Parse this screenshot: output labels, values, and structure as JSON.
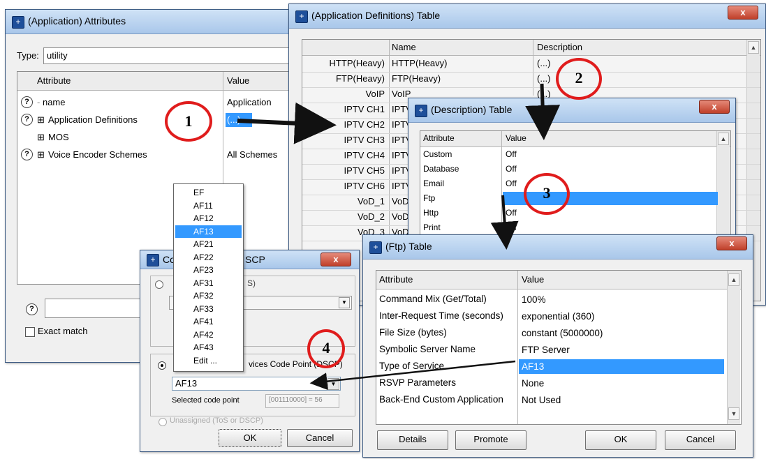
{
  "attributes_window": {
    "title": "(Application) Attributes",
    "type_label": "Type:",
    "type_value": "utility",
    "col_attribute": "Attribute",
    "col_value": "Value",
    "rows": [
      {
        "attr": "name",
        "value": "Application"
      },
      {
        "attr": "Application Definitions",
        "value": "(...)"
      },
      {
        "attr": "MOS",
        "value": ""
      },
      {
        "attr": "Voice Encoder Schemes",
        "value": "All Schemes"
      }
    ],
    "exact_match_label": "Exact match"
  },
  "app_defs_window": {
    "title": "(Application Definitions) Table",
    "col_name": "Name",
    "col_description": "Description",
    "rows": [
      {
        "label": "HTTP(Heavy)",
        "name": "HTTP(Heavy)",
        "desc": "(...)"
      },
      {
        "label": "FTP(Heavy)",
        "name": "FTP(Heavy)",
        "desc": "(...)"
      },
      {
        "label": "VoIP",
        "name": "VoIP",
        "desc": "(...)"
      },
      {
        "label": "IPTV CH1",
        "name": "IPTV",
        "desc": ""
      },
      {
        "label": "IPTV CH2",
        "name": "IPTV",
        "desc": ""
      },
      {
        "label": "IPTV CH3",
        "name": "IPTV",
        "desc": ""
      },
      {
        "label": "IPTV CH4",
        "name": "IPTV",
        "desc": ""
      },
      {
        "label": "IPTV CH5",
        "name": "IPTV",
        "desc": ""
      },
      {
        "label": "IPTV CH6",
        "name": "IPTV",
        "desc": ""
      },
      {
        "label": "VoD_1",
        "name": "VoD",
        "desc": ""
      },
      {
        "label": "VoD_2",
        "name": "VoD",
        "desc": ""
      },
      {
        "label": "VoD_3",
        "name": "VoD",
        "desc": ""
      }
    ]
  },
  "description_window": {
    "title": "(Description) Table",
    "col_attribute": "Attribute",
    "col_value": "Value",
    "rows": [
      {
        "attr": "Custom",
        "value": "Off"
      },
      {
        "attr": "Database",
        "value": "Off"
      },
      {
        "attr": "Email",
        "value": "Off"
      },
      {
        "attr": "Ftp",
        "value": ""
      },
      {
        "attr": "Http",
        "value": "Off"
      },
      {
        "attr": "Print",
        "value": "Off"
      }
    ]
  },
  "ftp_window": {
    "title": "(Ftp) Table",
    "col_attribute": "Attribute",
    "col_value": "Value",
    "rows": [
      {
        "attr": "Command Mix (Get/Total)",
        "value": "100%"
      },
      {
        "attr": "Inter-Request Time (seconds)",
        "value": "exponential (360)"
      },
      {
        "attr": "File Size (bytes)",
        "value": "constant (5000000)"
      },
      {
        "attr": "Symbolic Server Name",
        "value": "FTP Server"
      },
      {
        "attr": "Type of Service",
        "value": "AF13"
      },
      {
        "attr": "RSVP Parameters",
        "value": "None"
      },
      {
        "attr": "Back-End Custom Application",
        "value": "Not Used"
      }
    ],
    "details_btn": "Details",
    "promote_btn": "Promote",
    "ok_btn": "OK",
    "cancel_btn": "Cancel"
  },
  "tos_window": {
    "title_left": "Co",
    "title_right": "SCP",
    "radio1_text": "S)",
    "radio2_text": "vices Code Point (DSCP)",
    "select_value": "AF13",
    "selected_code_label": "Selected code point",
    "selected_code_value": "[001110000] = 56",
    "radio3_text": "Unassigned (ToS or DSCP)",
    "ok_btn": "OK",
    "cancel_btn": "Cancel"
  },
  "dropdown": {
    "options": [
      "EF",
      "AF11",
      "AF12",
      "AF13",
      "AF21",
      "AF22",
      "AF23",
      "AF31",
      "AF32",
      "AF33",
      "AF41",
      "AF42",
      "AF43",
      "Edit ..."
    ],
    "selected": "AF13"
  },
  "callouts": [
    "1",
    "2",
    "3",
    "4"
  ],
  "colors": {
    "title_bar": "#b4cdec",
    "selection": "#3399ff",
    "callout_red": "#e01c1c",
    "close_button": "#c94a35"
  }
}
